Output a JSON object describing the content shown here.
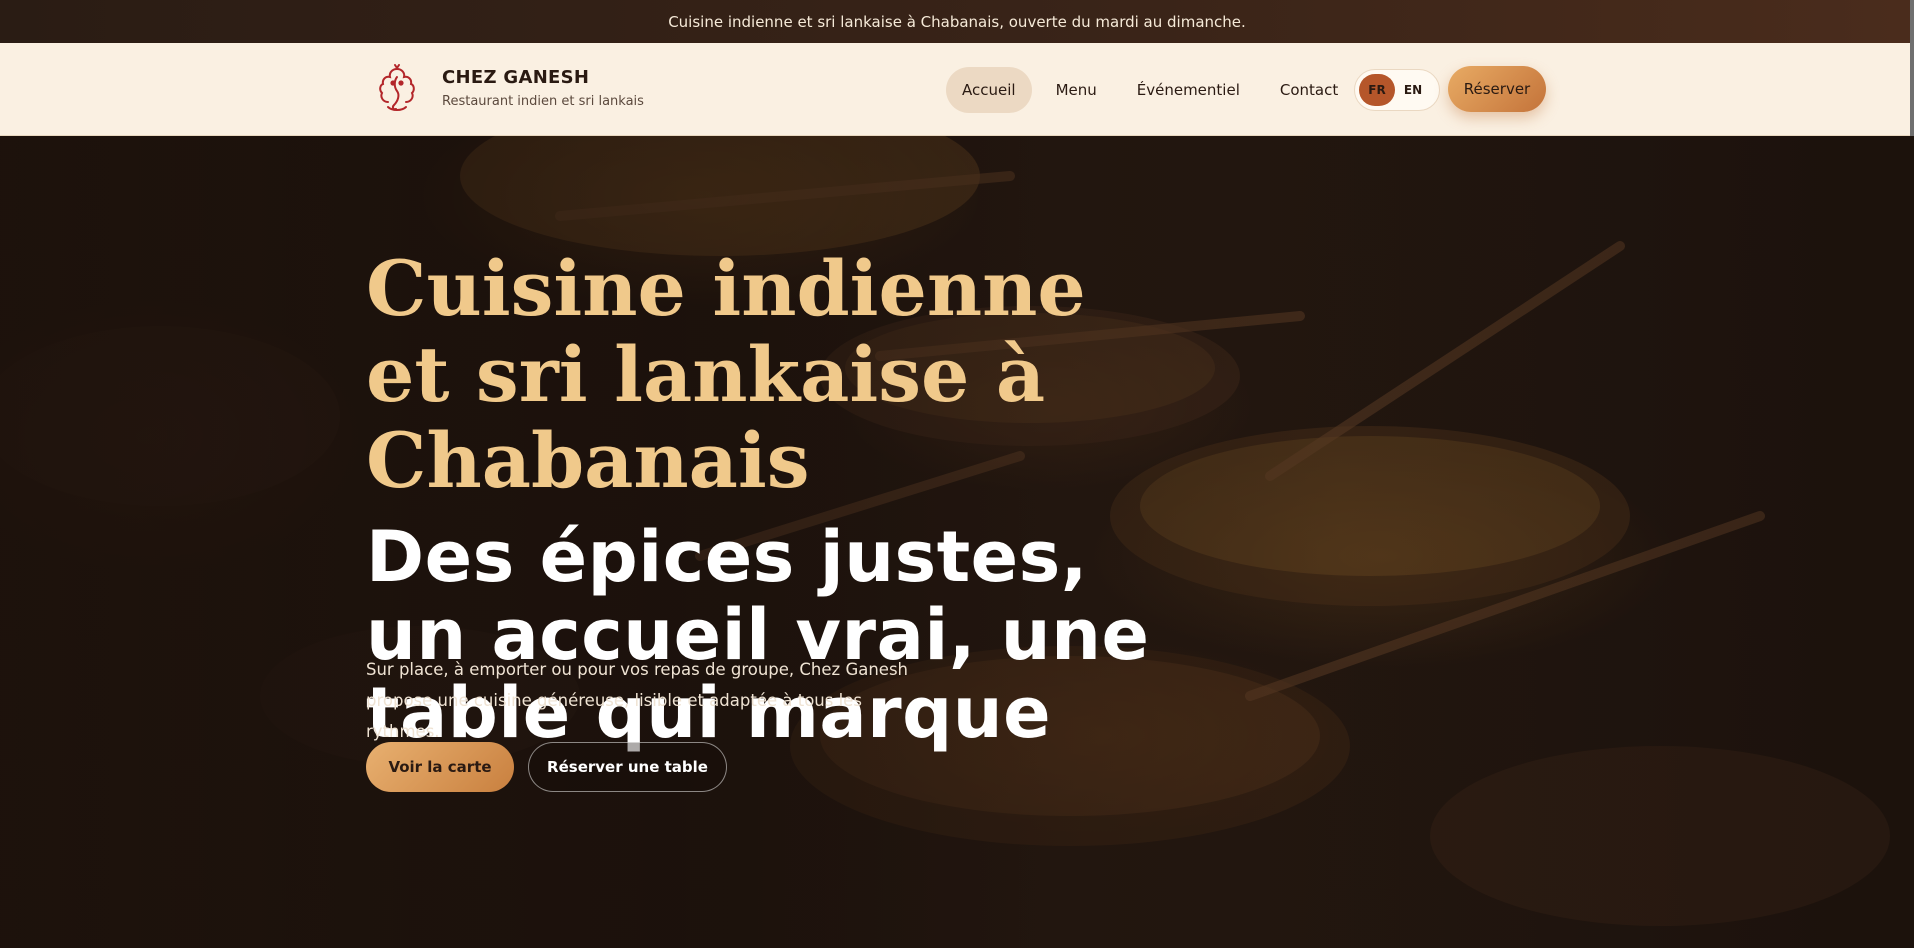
{
  "topbar": {
    "message": "Cuisine indienne et sri lankaise à Chabanais, ouverte du mardi au dimanche."
  },
  "brand": {
    "name": "CHEZ GANESH",
    "subtitle": "Restaurant indien et sri lankais",
    "logo_icon": "ganesh-logo-icon"
  },
  "nav": {
    "items": [
      {
        "label": "Accueil",
        "active": true
      },
      {
        "label": "Menu",
        "active": false
      },
      {
        "label": "Événementiel",
        "active": false
      },
      {
        "label": "Contact",
        "active": false
      }
    ]
  },
  "language": {
    "options": [
      "FR",
      "EN"
    ],
    "selected": "FR"
  },
  "header_cta": {
    "label": "Réserver"
  },
  "hero": {
    "kicker": "Cuisine indienne et sri lankaise à Chabanais",
    "title": "Des épices justes, un accueil vrai, une table qui marque",
    "text": "Sur place, à emporter ou pour vos repas de groupe, Chez Ganesh propose une cuisine généreuse, lisible et adaptée à tous les rythmes.",
    "primary_button": "Voir la carte",
    "secondary_button": "Réserver une table"
  },
  "colors": {
    "accent": "#d99353",
    "accent_dark": "#b5562a",
    "kicker": "#f0c98b",
    "header_bg": "#faf0e2",
    "topbar_bg": "#3a2418"
  }
}
